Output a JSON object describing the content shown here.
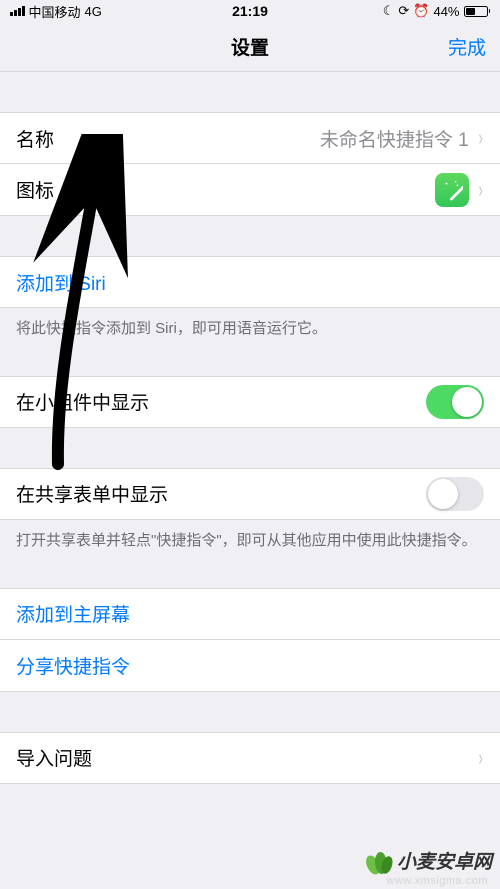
{
  "status": {
    "carrier": "中国移动",
    "network": "4G",
    "time": "21:19",
    "battery_pct": "44%",
    "battery_fill_pct": 44
  },
  "nav": {
    "title": "设置",
    "done": "完成"
  },
  "rows": {
    "name": {
      "label": "名称",
      "value": "未命名快捷指令 1"
    },
    "icon": {
      "label": "图标"
    },
    "add_siri": {
      "label": "添加到 Siri",
      "footer": "将此快捷指令添加到 Siri，即可用语音运行它。"
    },
    "show_widget": {
      "label": "在小组件中显示",
      "on": true
    },
    "show_share": {
      "label": "在共享表单中显示",
      "on": false,
      "footer": "打开共享表单并轻点\"快捷指令\"，即可从其他应用中使用此快捷指令。"
    },
    "add_home": {
      "label": "添加到主屏幕"
    },
    "share": {
      "label": "分享快捷指令"
    },
    "import": {
      "label": "导入问题"
    }
  },
  "watermark": {
    "brand": "小麦安卓网",
    "url": "www.xmsigma.com"
  },
  "colors": {
    "link": "#007aff",
    "switch_on": "#4cd964",
    "icon_bg": "#34c759"
  }
}
